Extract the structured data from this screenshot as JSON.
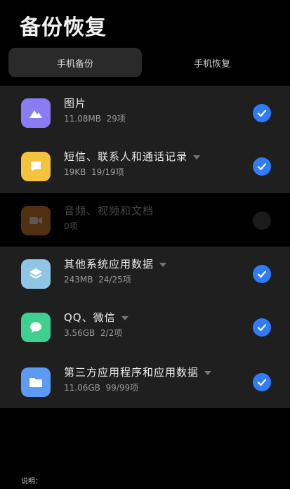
{
  "header": {
    "title": "备份恢复"
  },
  "tabs": [
    {
      "label": "手机备份",
      "active": true
    },
    {
      "label": "手机恢复",
      "active": false
    }
  ],
  "items": [
    {
      "name": "图片",
      "size": "11.08MB",
      "count": "29项",
      "icon": "image-icon",
      "color": "#8b7cf6",
      "checked": true,
      "has_caret": false
    },
    {
      "name": "短信、联系人和通话记录",
      "size": "19KB",
      "count": "19/19项",
      "icon": "message-icon",
      "color": "#f5c33b",
      "checked": true,
      "has_caret": true
    },
    {
      "name": "音频、视频和文档",
      "size": "",
      "count": "0项",
      "icon": "video-icon",
      "color": "#e58a2e",
      "checked": false,
      "has_caret": false
    },
    {
      "name": "其他系统应用数据",
      "size": "243MB",
      "count": "24/25项",
      "icon": "layers-icon",
      "color": "#8fc6e6",
      "checked": true,
      "has_caret": true
    },
    {
      "name": "QQ、微信",
      "size": "3.56GB",
      "count": "2/2项",
      "icon": "chat-icon",
      "color": "#3fcf8e",
      "checked": true,
      "has_caret": true
    },
    {
      "name": "第三方应用程序和应用数据",
      "size": "11.06GB",
      "count": "99/99项",
      "icon": "folder-icon",
      "color": "#5b9bf5",
      "checked": true,
      "has_caret": true
    }
  ],
  "notes": {
    "label": "说明："
  },
  "colors": {
    "accent": "#2f7cf6",
    "background": "#000000",
    "panel": "#1f1f1f"
  }
}
